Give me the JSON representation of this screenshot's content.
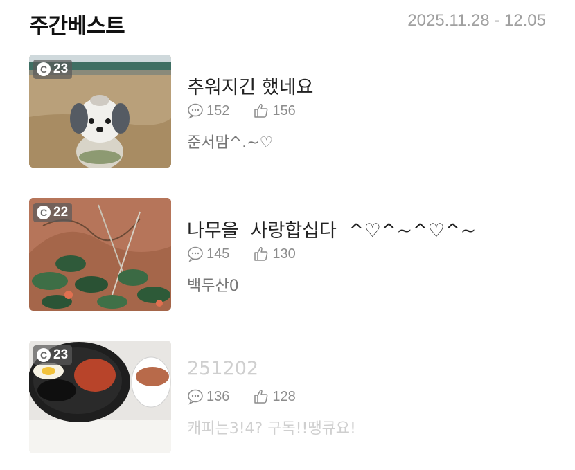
{
  "header": {
    "title": "주간베스트",
    "date_range": "2025.11.28 - 12.05"
  },
  "posts": [
    {
      "rank_badge": "23",
      "title": "추워지긴 했네요",
      "comments": "152",
      "likes": "156",
      "author": "준서맘^.~♡",
      "thumb_icon": "dog-photo"
    },
    {
      "rank_badge": "22",
      "title": "나무을  사랑합십다  ^♡^~^♡^~",
      "comments": "145",
      "likes": "130",
      "author": "백두산0",
      "thumb_icon": "plant-photo"
    },
    {
      "rank_badge": "23",
      "title": "251202",
      "comments": "136",
      "likes": "128",
      "author": "캐피는3!4? 구독!!땡큐요!",
      "thumb_icon": "food-photo"
    }
  ],
  "colors": {
    "muted_text": "#8c8c8c",
    "date_text": "#a0a0a0",
    "faded_text": "#cfcfcf",
    "badge_bg": "#5a5a5a"
  }
}
